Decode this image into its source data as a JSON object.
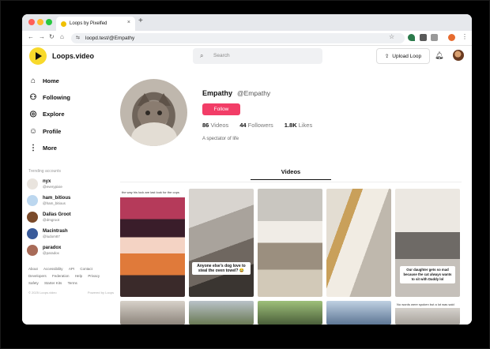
{
  "browser": {
    "tab_title": "Loops by Pixelfed",
    "tab_close": "×",
    "new_tab": "+",
    "url": "loopd.test/@Empathy"
  },
  "header": {
    "logo_text": "Loops.video",
    "search_placeholder": "Search",
    "upload_label": "Upload Loop"
  },
  "sidebar": {
    "nav": [
      {
        "label": "Home",
        "icon": "home-icon"
      },
      {
        "label": "Following",
        "icon": "user-plus-icon"
      },
      {
        "label": "Explore",
        "icon": "compass-icon"
      },
      {
        "label": "Profile",
        "icon": "user-icon"
      },
      {
        "label": "More",
        "icon": "more-vertical-icon"
      }
    ],
    "section_label": "Trending accounts",
    "accounts": [
      {
        "name": "nyx",
        "handle": "@everypixie",
        "color": "#e9e4de"
      },
      {
        "name": "ham_bitious",
        "handle": "@ham_bitious",
        "color": "#bcd7ef"
      },
      {
        "name": "Dallas Groot",
        "handle": "@dmgroot",
        "color": "#7a4a2a"
      },
      {
        "name": "Macintrash",
        "handle": "@ludom87",
        "color": "#3a5b9a"
      },
      {
        "name": "paradox",
        "handle": "@paradox",
        "color": "#a86b58"
      }
    ],
    "footer_links": [
      "About",
      "Accessibility",
      "API",
      "Contact",
      "Developers",
      "Federation",
      "Help",
      "Privacy",
      "Safety",
      "Starter Kits",
      "Terms"
    ],
    "copyright": "© 2025 Loops.video",
    "powered_by": "Powered by Loops"
  },
  "profile": {
    "display_name": "Empathy",
    "handle": "@Empathy",
    "follow_label": "Follow",
    "videos_count": "86",
    "videos_label": "Videos",
    "followers_count": "44",
    "followers_label": "Followers",
    "likes_count": "1.8K",
    "likes_label": "Likes",
    "bio": "A spectator of life",
    "tab_videos": "Videos"
  },
  "videos": [
    {
      "top_caption": "the way his lock are last look for the cops",
      "caption": ""
    },
    {
      "top_caption": "",
      "caption": "Anyone else's dog love to steal the oven towel? 😂"
    },
    {
      "top_caption": "",
      "caption": ""
    },
    {
      "top_caption": "",
      "caption": ""
    },
    {
      "top_caption": "",
      "caption": "Our daughter gets so mad because the cat always wants to sit with Daddy lol"
    },
    {
      "top_caption": "",
      "caption": ""
    },
    {
      "top_caption": "",
      "caption": ""
    },
    {
      "top_caption": "",
      "caption": ""
    },
    {
      "top_caption": "",
      "caption": ""
    },
    {
      "top_caption": "No words were spoken but a lot was said",
      "caption": ""
    }
  ],
  "colors": {
    "brand_yellow": "#f8d92b",
    "follow_pink": "#f23d67"
  }
}
